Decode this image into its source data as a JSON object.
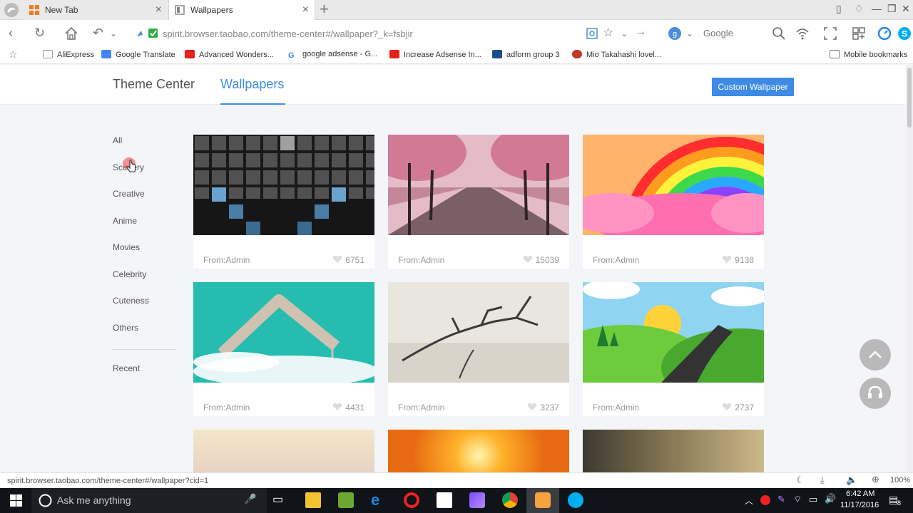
{
  "browser": {
    "tabs": [
      {
        "title": "New Tab",
        "active": false
      },
      {
        "title": "Wallpapers",
        "active": true
      }
    ],
    "url": "spirit.browser.taobao.com/theme-center#/wallpaper?_k=fsbjir",
    "search_engine": "Google",
    "bookmarks": [
      {
        "label": "AliExpress",
        "color": "#888888"
      },
      {
        "label": "Google Translate",
        "color": "#4285f4"
      },
      {
        "label": "Advanced Wonders...",
        "color": "#e62117"
      },
      {
        "label": "google adsense - G...",
        "color": "#4285f4"
      },
      {
        "label": "Increase Adsense In...",
        "color": "#e62117"
      },
      {
        "label": "adform group 3",
        "color": "#1b4f8a"
      },
      {
        "label": "Mio Takahashi lovel...",
        "color": "#c0392b"
      }
    ],
    "mobile_bookmarks": "Mobile bookmarks",
    "status_url": "spirit.browser.taobao.com/theme-center#/wallpaper?cid=1",
    "zoom": "100%"
  },
  "page": {
    "header_title": "Theme Center",
    "active_tab": "Wallpapers",
    "custom_button": "Custom Wallpaper",
    "categories": [
      "All",
      "Scenery",
      "Creative",
      "Anime",
      "Movies",
      "Celebrity",
      "Cuteness",
      "Others"
    ],
    "recent": "Recent",
    "wallpapers": [
      {
        "from": "From:Admin",
        "likes": "6751",
        "subject": "dark tiles"
      },
      {
        "from": "From:Admin",
        "likes": "15039",
        "subject": "cherry blossom avenue"
      },
      {
        "from": "From:Admin",
        "likes": "9138",
        "subject": "rainbow clouds"
      },
      {
        "from": "From:Admin",
        "likes": "4431",
        "subject": "floating frame"
      },
      {
        "from": "From:Admin",
        "likes": "3237",
        "subject": "driftwood beach"
      },
      {
        "from": "From:Admin",
        "likes": "2737",
        "subject": "cartoon hills"
      }
    ]
  },
  "taskbar": {
    "search_placeholder": "Ask me anything",
    "time": "6:42 AM",
    "date": "11/17/2016",
    "notifications": "8"
  },
  "colors": {
    "accent": "#3d8be4",
    "taskbar": "#101317"
  }
}
